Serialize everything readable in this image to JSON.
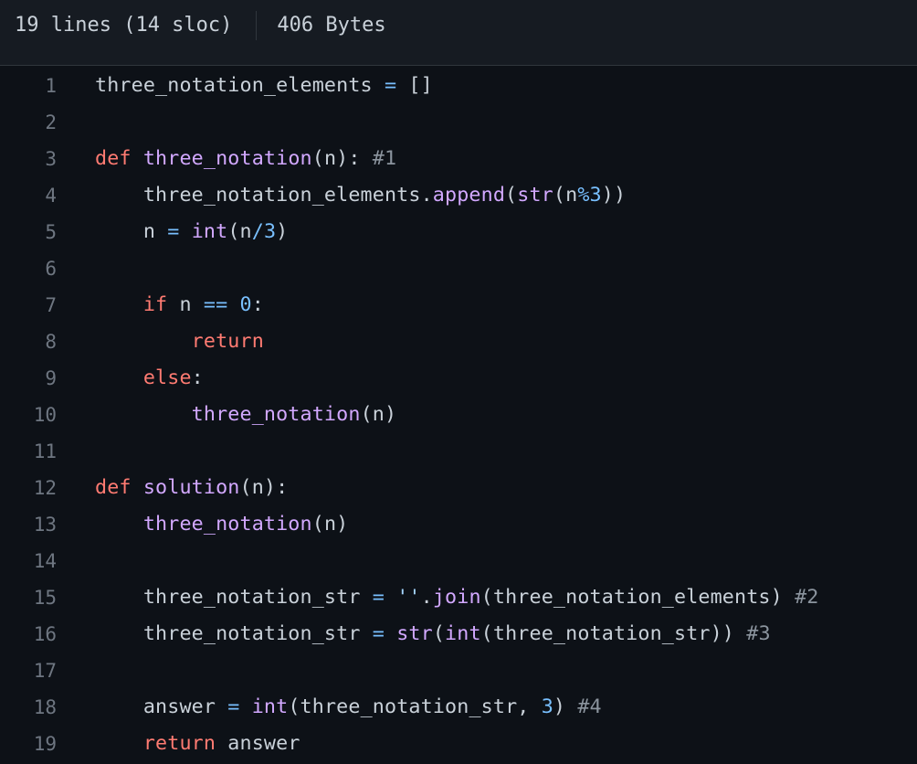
{
  "header": {
    "lines_info": "19 lines (14 sloc)",
    "size_info": "406 Bytes"
  },
  "code": {
    "lines": [
      [
        {
          "t": "pl",
          "s": "three_notation_elements "
        },
        {
          "t": "op",
          "s": "="
        },
        {
          "t": "pl",
          "s": " []"
        }
      ],
      [],
      [
        {
          "t": "kw",
          "s": "def"
        },
        {
          "t": "pl",
          "s": " "
        },
        {
          "t": "fn",
          "s": "three_notation"
        },
        {
          "t": "pl",
          "s": "(n): "
        },
        {
          "t": "cm",
          "s": "#1"
        }
      ],
      [
        {
          "t": "pl",
          "s": "    three_notation_elements."
        },
        {
          "t": "fn",
          "s": "append"
        },
        {
          "t": "pl",
          "s": "("
        },
        {
          "t": "bi",
          "s": "str"
        },
        {
          "t": "pl",
          "s": "(n"
        },
        {
          "t": "op",
          "s": "%"
        },
        {
          "t": "num",
          "s": "3"
        },
        {
          "t": "pl",
          "s": "))"
        }
      ],
      [
        {
          "t": "pl",
          "s": "    n "
        },
        {
          "t": "op",
          "s": "="
        },
        {
          "t": "pl",
          "s": " "
        },
        {
          "t": "bi",
          "s": "int"
        },
        {
          "t": "pl",
          "s": "(n"
        },
        {
          "t": "op",
          "s": "/"
        },
        {
          "t": "num",
          "s": "3"
        },
        {
          "t": "pl",
          "s": ")"
        }
      ],
      [],
      [
        {
          "t": "pl",
          "s": "    "
        },
        {
          "t": "kw",
          "s": "if"
        },
        {
          "t": "pl",
          "s": " n "
        },
        {
          "t": "op",
          "s": "=="
        },
        {
          "t": "pl",
          "s": " "
        },
        {
          "t": "num",
          "s": "0"
        },
        {
          "t": "pl",
          "s": ":"
        }
      ],
      [
        {
          "t": "pl",
          "s": "        "
        },
        {
          "t": "kw",
          "s": "return"
        }
      ],
      [
        {
          "t": "pl",
          "s": "    "
        },
        {
          "t": "kw",
          "s": "else"
        },
        {
          "t": "pl",
          "s": ":"
        }
      ],
      [
        {
          "t": "pl",
          "s": "        "
        },
        {
          "t": "fn",
          "s": "three_notation"
        },
        {
          "t": "pl",
          "s": "(n)"
        }
      ],
      [],
      [
        {
          "t": "kw",
          "s": "def"
        },
        {
          "t": "pl",
          "s": " "
        },
        {
          "t": "fn",
          "s": "solution"
        },
        {
          "t": "pl",
          "s": "(n):"
        }
      ],
      [
        {
          "t": "pl",
          "s": "    "
        },
        {
          "t": "fn",
          "s": "three_notation"
        },
        {
          "t": "pl",
          "s": "(n)"
        }
      ],
      [],
      [
        {
          "t": "pl",
          "s": "    three_notation_str "
        },
        {
          "t": "op",
          "s": "="
        },
        {
          "t": "pl",
          "s": " "
        },
        {
          "t": "str",
          "s": "''"
        },
        {
          "t": "pl",
          "s": "."
        },
        {
          "t": "fn",
          "s": "join"
        },
        {
          "t": "pl",
          "s": "(three_notation_elements) "
        },
        {
          "t": "cm",
          "s": "#2"
        }
      ],
      [
        {
          "t": "pl",
          "s": "    three_notation_str "
        },
        {
          "t": "op",
          "s": "="
        },
        {
          "t": "pl",
          "s": " "
        },
        {
          "t": "bi",
          "s": "str"
        },
        {
          "t": "pl",
          "s": "("
        },
        {
          "t": "bi",
          "s": "int"
        },
        {
          "t": "pl",
          "s": "(three_notation_str)) "
        },
        {
          "t": "cm",
          "s": "#3"
        }
      ],
      [],
      [
        {
          "t": "pl",
          "s": "    answer "
        },
        {
          "t": "op",
          "s": "="
        },
        {
          "t": "pl",
          "s": " "
        },
        {
          "t": "bi",
          "s": "int"
        },
        {
          "t": "pl",
          "s": "(three_notation_str, "
        },
        {
          "t": "num",
          "s": "3"
        },
        {
          "t": "pl",
          "s": ") "
        },
        {
          "t": "cm",
          "s": "#4"
        }
      ],
      [
        {
          "t": "pl",
          "s": "    "
        },
        {
          "t": "kw",
          "s": "return"
        },
        {
          "t": "pl",
          "s": " answer"
        }
      ]
    ]
  }
}
